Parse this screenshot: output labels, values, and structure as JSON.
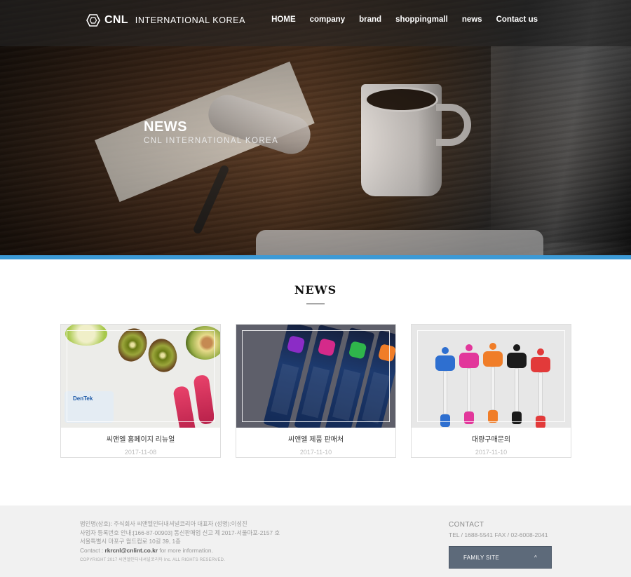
{
  "header": {
    "logo_strong": "CNL",
    "logo_light": "INTERNATIONAL KOREA",
    "nav": [
      "HOME",
      "company",
      "brand",
      "shoppingmall",
      "news",
      "Contact us"
    ]
  },
  "hero": {
    "title": "NEWS",
    "subtitle": "CNL INTERNATIONAL KOREA"
  },
  "section": {
    "title": "NEWS"
  },
  "cards": [
    {
      "title": "씨앤엘 홈페이지 리뉴얼",
      "date": "2017-11-08"
    },
    {
      "title": "씨앤엘 제품 판매처",
      "date": "2017-11-10"
    },
    {
      "title": "대량구매문의",
      "date": "2017-11-10"
    }
  ],
  "footer": {
    "info_lines": [
      "법인명(상호): 주식회사 씨앤엘인터내셔널코리아 대표자 (성명):이성진",
      "사업자 등록번호 안내:[166-87-00903] 통신판매업 신고 제 2017-서울마포-2157 호",
      "서울특별시 마포구 월드컵로 10길 39, 1층"
    ],
    "contact_prefix": "Contact :",
    "contact_email": "rkrcnl@cnlint.co.kr",
    "contact_suffix": "for more information.",
    "copyright": "COPYRIGHT 2017 씨앤엘인터내셔널코리아 Inc. ALL RIGHTS RESERVED.",
    "contact_title": "CONTACT",
    "contact_line": "TEL / 1688-5541    FAX / 02-6008-2041",
    "family_site": "FAMILY SITE",
    "family_arrow": "^"
  },
  "colors": {
    "accent_bar": "#3c9ad6",
    "family_button": "#5d6a7a"
  }
}
